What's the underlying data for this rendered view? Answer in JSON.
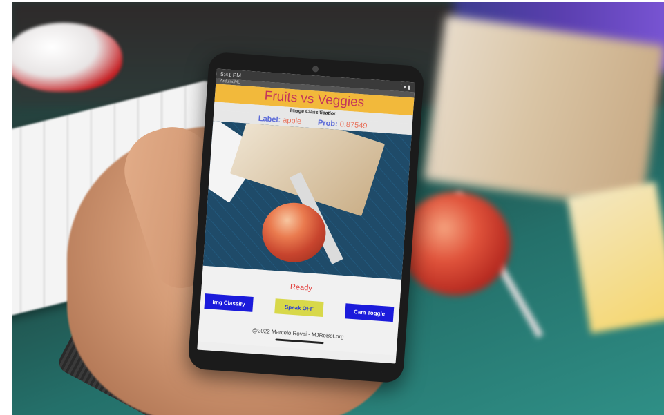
{
  "status_bar": {
    "time": "5:41 PM",
    "right_icons": "⁞ ▾ ▮"
  },
  "app_bar_title": "ArduinoML",
  "app": {
    "title": "Fruits vs Veggies",
    "subtitle": "Image Classification",
    "label_caption": "Label:",
    "label_value": "apple",
    "prob_caption": "Prob:",
    "prob_value": "0.87549",
    "status": "Ready",
    "buttons": {
      "classify": "Img Classify",
      "speak": "Speak OFF",
      "cam": "Cam Toggle"
    },
    "footer": "@2022 Marcelo Rovai - MJRoBot.org"
  },
  "colors": {
    "title_banner": "#f2b93b",
    "title_text": "#c4365a",
    "button_blue": "#1b1bdb",
    "button_yellow": "#d8d84a",
    "ready_text": "#e2403e"
  }
}
